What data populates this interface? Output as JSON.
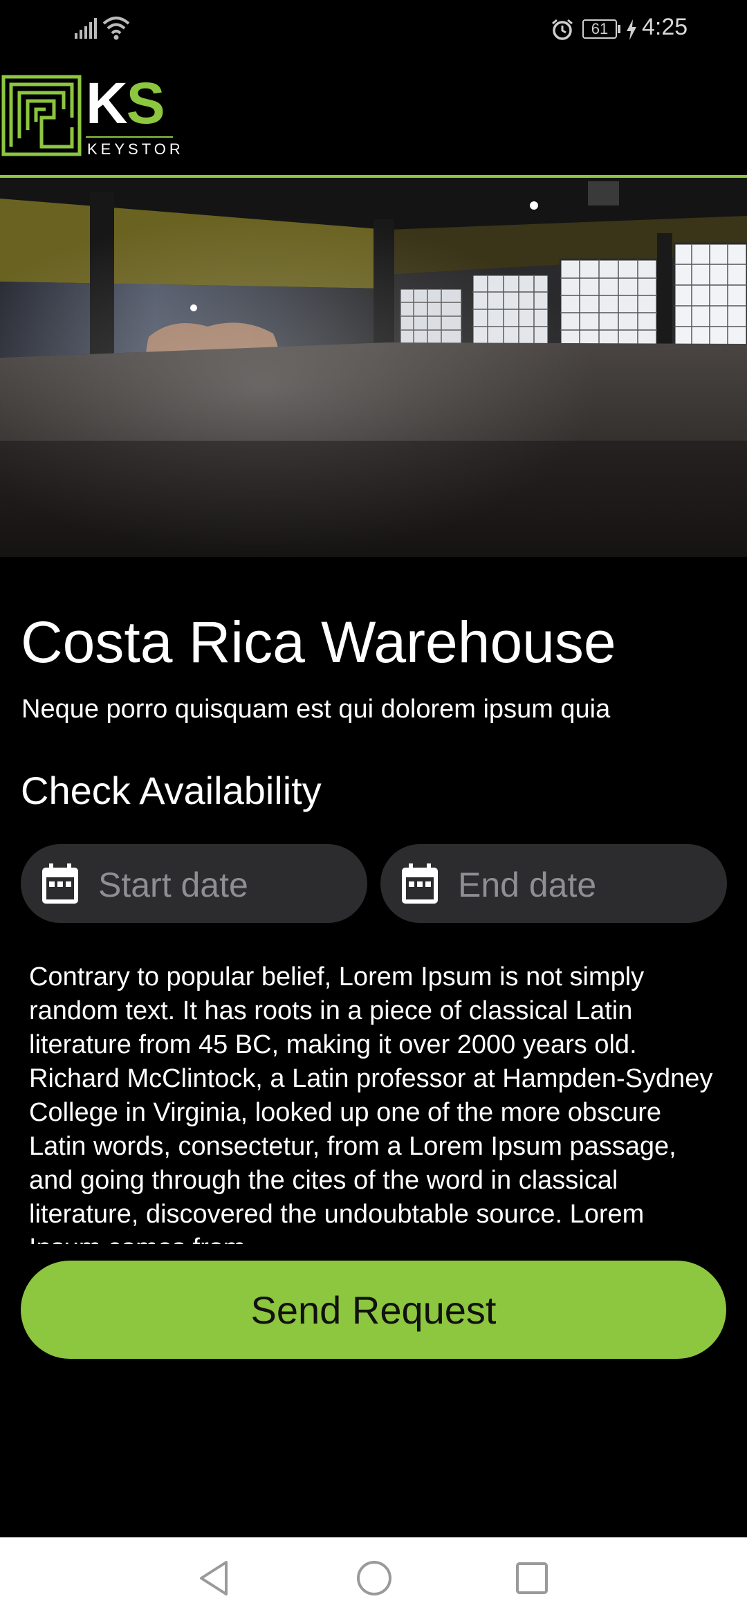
{
  "status_bar": {
    "time": "4:25",
    "battery": "61"
  },
  "brand": {
    "letter_k": "K",
    "letter_s": "S",
    "wordmark": "KEYSTOR",
    "accent": "#8dc63f"
  },
  "warehouse": {
    "title": "Costa Rica Warehouse",
    "subtitle": "Neque porro quisquam est qui dolorem ipsum quia"
  },
  "availability": {
    "heading": "Check Availability",
    "start_placeholder": "Start date",
    "end_placeholder": "End date"
  },
  "description": "Contrary to popular belief, Lorem Ipsum is not simply random text. It has roots in a piece of classical Latin literature from 45 BC, making it over 2000 years old. Richard McClintock, a Latin professor at Hampden-Sydney College in Virginia, looked up one of the more obscure Latin words, consectetur, from a Lorem Ipsum passage, and going through the cites of the word in classical literature, discovered the undoubtable source. Lorem Ipsum comes from",
  "actions": {
    "send_label": "Send Request"
  },
  "icons": {
    "signal": "signal-icon",
    "wifi": "wifi-icon",
    "alarm": "alarm-icon",
    "calendar": "calendar-icon",
    "back": "back-icon",
    "home": "home-icon",
    "recents": "recents-icon"
  }
}
